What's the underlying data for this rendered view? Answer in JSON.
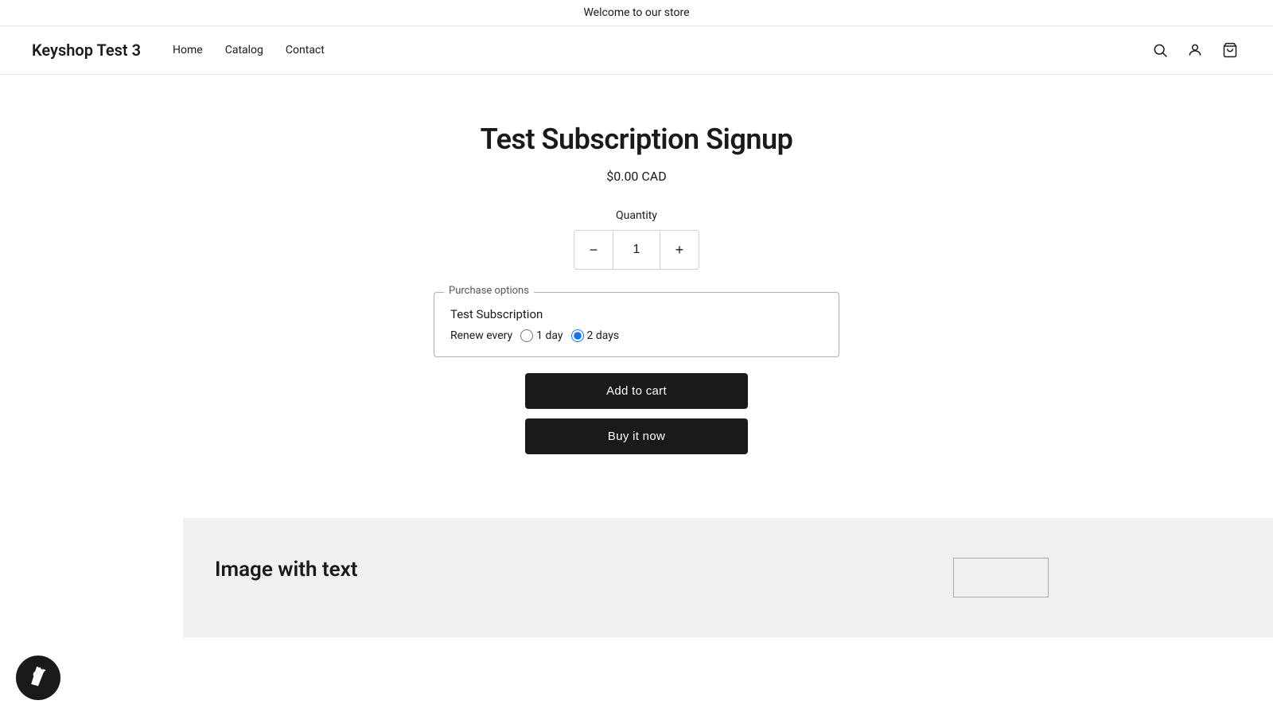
{
  "announcement": {
    "text": "Welcome to our store"
  },
  "header": {
    "logo": "Keyshop Test 3",
    "nav": [
      {
        "label": "Home",
        "href": "#"
      },
      {
        "label": "Catalog",
        "href": "#"
      },
      {
        "label": "Contact",
        "href": "#"
      }
    ],
    "icons": {
      "search": "search-icon",
      "account": "account-icon",
      "cart": "cart-icon"
    }
  },
  "product": {
    "title": "Test Subscription Signup",
    "price": "$0.00 CAD",
    "quantity_label": "Quantity",
    "quantity_value": "1",
    "purchase_options_legend": "Purchase options",
    "subscription_name": "Test Subscription",
    "renew_label": "Renew every",
    "options": [
      {
        "label": "1 day",
        "value": "1day",
        "checked": false
      },
      {
        "label": "2 days",
        "value": "2days",
        "checked": true
      }
    ]
  },
  "buttons": {
    "add_to_cart": "Add to cart",
    "buy_it_now": "Buy it now"
  },
  "bottom": {
    "title": "Image with text"
  }
}
